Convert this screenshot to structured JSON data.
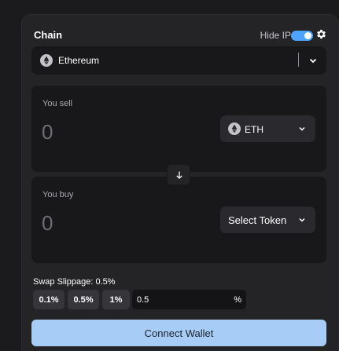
{
  "header": {
    "title": "Chain",
    "hide_ip_label": "Hide IP",
    "hide_ip_enabled": true
  },
  "chain_select": {
    "selected": "Ethereum",
    "icon": "ethereum-icon"
  },
  "sell": {
    "label": "You sell",
    "amount": "0",
    "token": "ETH",
    "token_icon": "ethereum-icon"
  },
  "buy": {
    "label": "You buy",
    "amount": "0",
    "token": "Select Token"
  },
  "slippage": {
    "label": "Swap Slippage: 0.5%",
    "options": [
      "0.1%",
      "0.5%",
      "1%"
    ],
    "custom_value": "0.5",
    "unit": "%"
  },
  "connect_label": "Connect Wallet",
  "colors": {
    "accent": "#4ea3ff",
    "connect_button": "#a7ccf5",
    "panel": "#242427",
    "field": "#18181a"
  }
}
